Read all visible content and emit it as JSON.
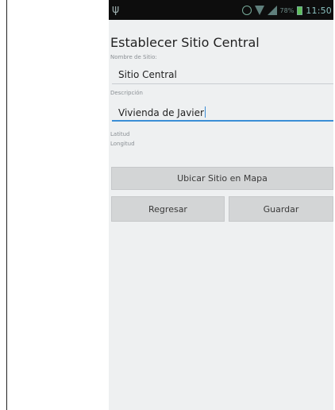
{
  "status_bar": {
    "battery_percent": "78%",
    "time": "11:50"
  },
  "screen": {
    "title": "Establecer Sitio Central",
    "name_label": "Nombre de Sitio:",
    "name_value": "Sitio Central",
    "description_label": "Descripción",
    "description_value": "Vivienda de Javier",
    "latitude_label": "Latitud",
    "longitude_label": "Longitud"
  },
  "buttons": {
    "locate_on_map": "Ubicar Sitio en Mapa",
    "back": "Regresar",
    "save": "Guardar"
  },
  "colors": {
    "accent": "#3b8ed6",
    "status_bar_bg": "#0d0d0d",
    "screen_bg": "#eef0f1",
    "button_bg": "#d3d5d6"
  }
}
